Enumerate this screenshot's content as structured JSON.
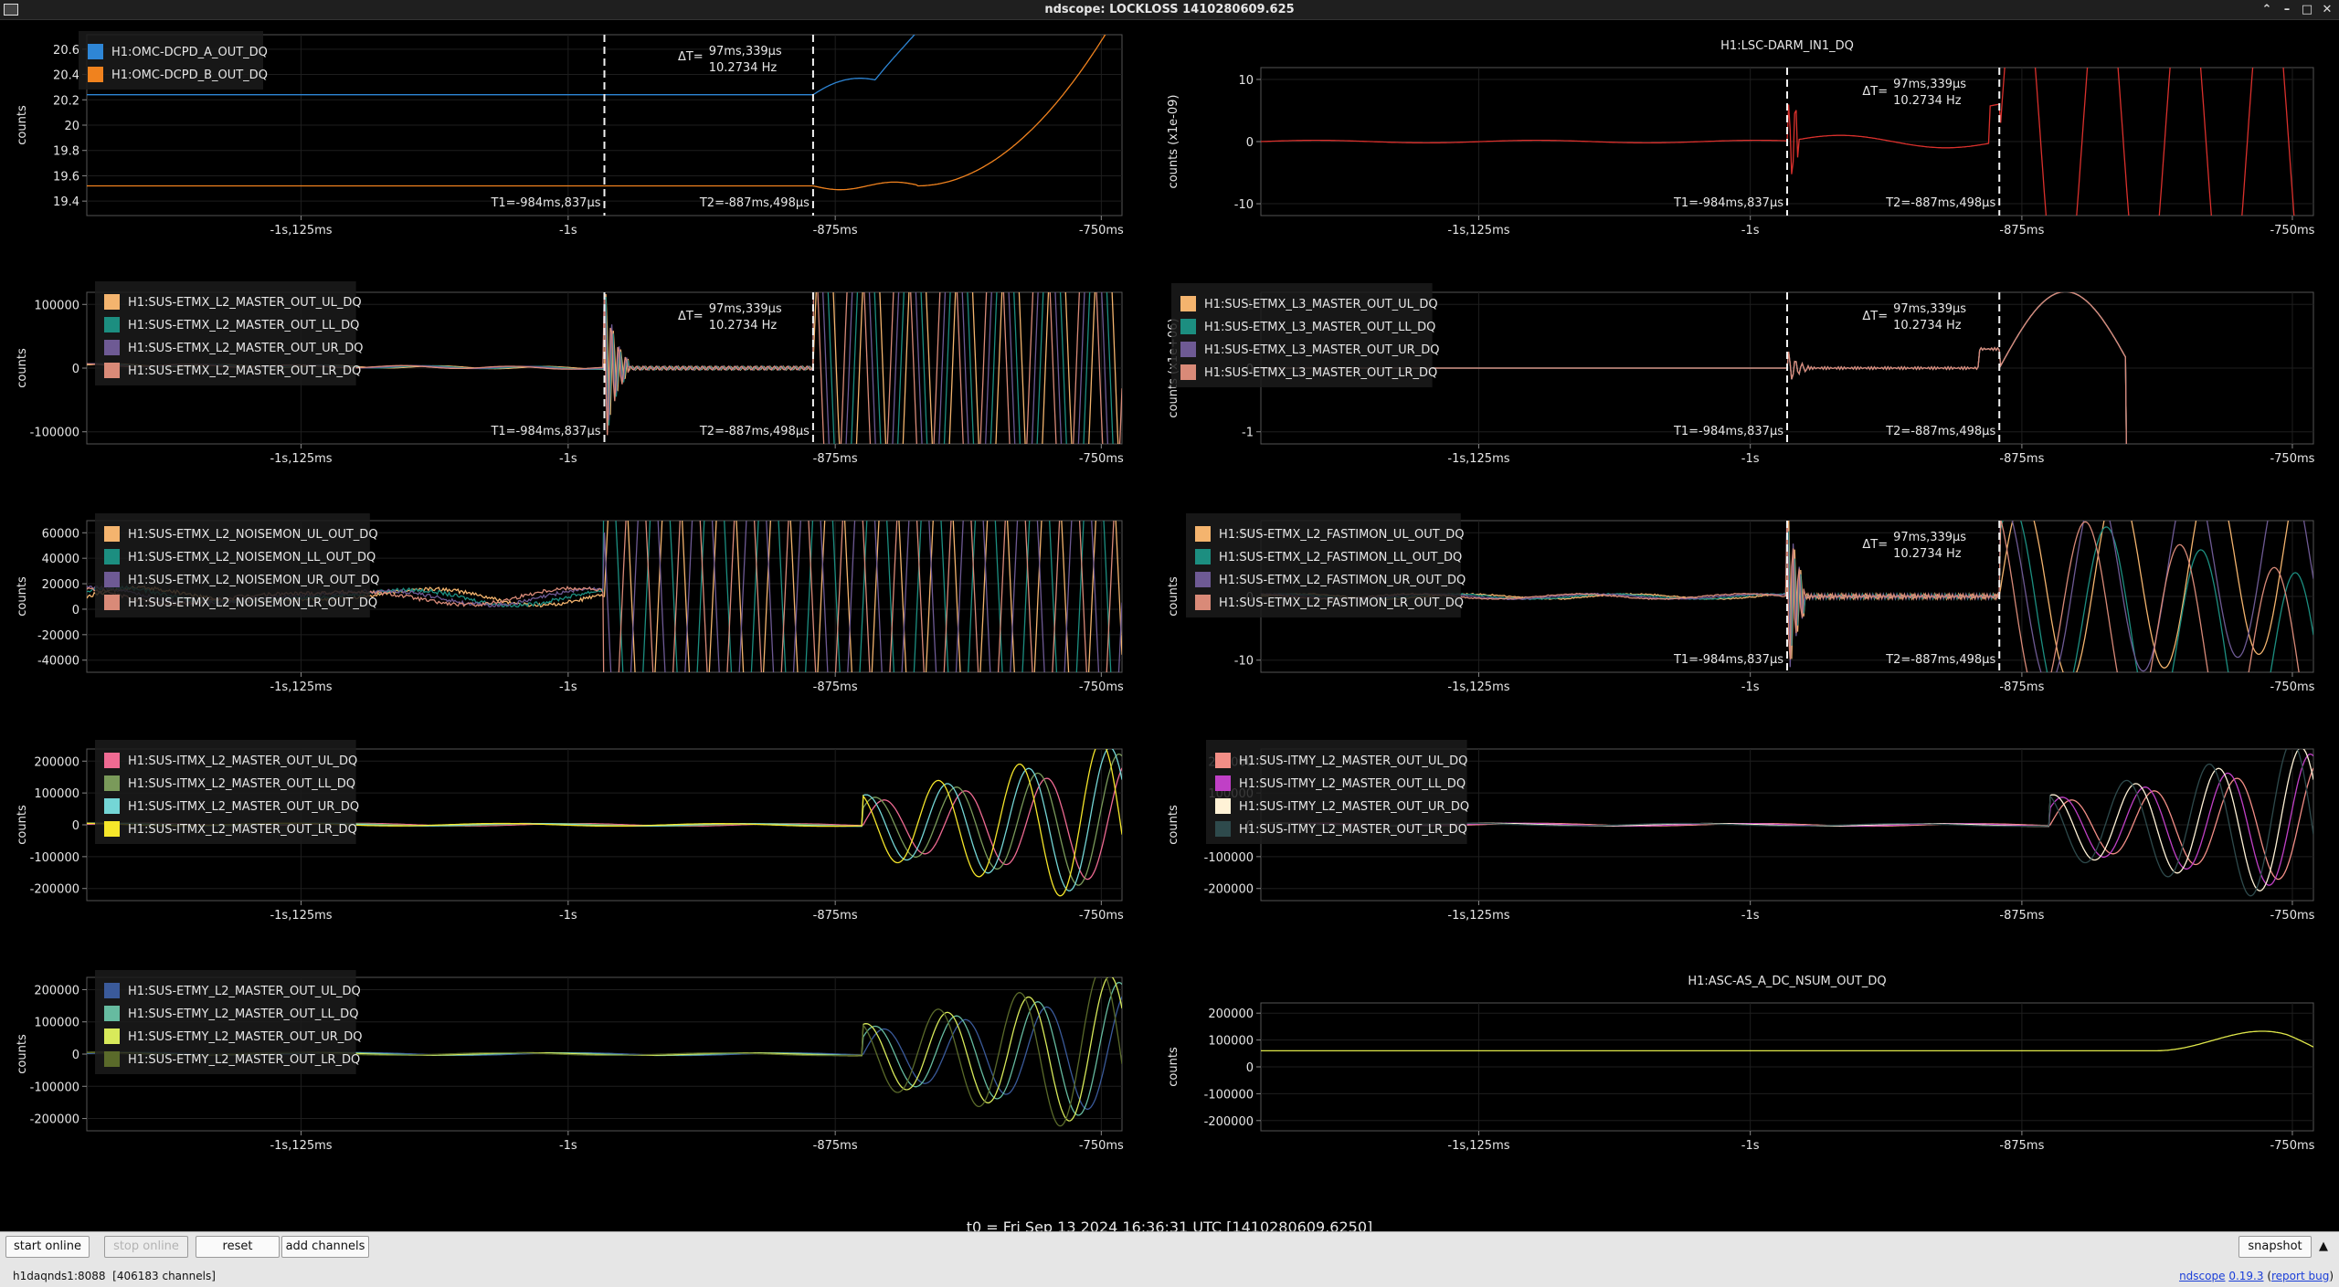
{
  "window": {
    "title": "ndscope: LOCKLOSS 1410280609.625"
  },
  "colors": {
    "c_blue": "#2e86d6",
    "c_orange": "#f0821e",
    "c_red": "#d9302c",
    "c_lo": "#f4b46e",
    "c_teal": "#1c8e80",
    "c_purple": "#6e5a94",
    "c_salmon": "#d98a78",
    "c_pink": "#ee6a92",
    "c_green": "#7a9a5a",
    "c_cyan": "#74d6d6",
    "c_yellow": "#f5e62a",
    "c_peach": "#f28e86",
    "c_magenta": "#c040c6",
    "c_cream": "#fff2d6",
    "c_dslate": "#2e4a4c",
    "c_navy": "#3a5a9a",
    "c_seafoam": "#66bba0",
    "c_lime": "#d8ea5a",
    "c_olive": "#5a6a2a",
    "c_nsum": "#e0e84a"
  },
  "x_ticks": [
    "-1s,125ms",
    "-1s",
    "-875ms",
    "-750ms"
  ],
  "cursor_labels": {
    "t1": "T1=-984ms,837μs",
    "t2": "T2=-887ms,498μs",
    "dt_prefix": "ΔT=",
    "dt_val": "97ms,339μs",
    "dt_freq": "10.2734 Hz"
  },
  "panels": [
    {
      "id": "p00",
      "title": "",
      "ylabel": "counts",
      "yticks": [
        "20.6",
        "20.4",
        "20.2",
        "20",
        "19.8",
        "19.6",
        "19.4"
      ],
      "channels": [
        {
          "name": "H1:OMC-DCPD_A_OUT_DQ",
          "color": "c_blue"
        },
        {
          "name": "H1:OMC-DCPD_B_OUT_DQ",
          "color": "c_orange"
        }
      ]
    },
    {
      "id": "p01",
      "title": "H1:LSC-DARM_IN1_DQ",
      "ylabel": "counts (x1e-09)",
      "yticks": [
        "10",
        "0",
        "-10"
      ],
      "channels": []
    },
    {
      "id": "p10",
      "title": "",
      "ylabel": "counts",
      "yticks": [
        "100000",
        "0",
        "-100000"
      ],
      "channels": [
        {
          "name": "H1:SUS-ETMX_L2_MASTER_OUT_UL_DQ",
          "color": "c_lo"
        },
        {
          "name": "H1:SUS-ETMX_L2_MASTER_OUT_LL_DQ",
          "color": "c_teal"
        },
        {
          "name": "H1:SUS-ETMX_L2_MASTER_OUT_UR_DQ",
          "color": "c_purple"
        },
        {
          "name": "H1:SUS-ETMX_L2_MASTER_OUT_LR_DQ",
          "color": "c_salmon"
        }
      ]
    },
    {
      "id": "p11",
      "title": "",
      "ylabel": "counts (x1e+06)",
      "yticks": [
        "1",
        "0",
        "-1"
      ],
      "channels": [
        {
          "name": "H1:SUS-ETMX_L3_MASTER_OUT_UL_DQ",
          "color": "c_lo"
        },
        {
          "name": "H1:SUS-ETMX_L3_MASTER_OUT_LL_DQ",
          "color": "c_teal"
        },
        {
          "name": "H1:SUS-ETMX_L3_MASTER_OUT_UR_DQ",
          "color": "c_purple"
        },
        {
          "name": "H1:SUS-ETMX_L3_MASTER_OUT_LR_DQ",
          "color": "c_salmon"
        }
      ]
    },
    {
      "id": "p20",
      "title": "",
      "ylabel": "counts",
      "yticks": [
        "60000",
        "40000",
        "20000",
        "0",
        "-20000",
        "-40000"
      ],
      "channels": [
        {
          "name": "H1:SUS-ETMX_L2_NOISEMON_UL_OUT_DQ",
          "color": "c_lo"
        },
        {
          "name": "H1:SUS-ETMX_L2_NOISEMON_LL_OUT_DQ",
          "color": "c_teal"
        },
        {
          "name": "H1:SUS-ETMX_L2_NOISEMON_UR_OUT_DQ",
          "color": "c_purple"
        },
        {
          "name": "H1:SUS-ETMX_L2_NOISEMON_LR_OUT_DQ",
          "color": "c_salmon"
        }
      ]
    },
    {
      "id": "p21",
      "title": "",
      "ylabel": "counts",
      "yticks": [
        "10",
        "0",
        "-10"
      ],
      "channels": [
        {
          "name": "H1:SUS-ETMX_L2_FASTIMON_UL_OUT_DQ",
          "color": "c_lo"
        },
        {
          "name": "H1:SUS-ETMX_L2_FASTIMON_LL_OUT_DQ",
          "color": "c_teal"
        },
        {
          "name": "H1:SUS-ETMX_L2_FASTIMON_UR_OUT_DQ",
          "color": "c_purple"
        },
        {
          "name": "H1:SUS-ETMX_L2_FASTIMON_LR_OUT_DQ",
          "color": "c_salmon"
        }
      ]
    },
    {
      "id": "p30",
      "title": "",
      "ylabel": "counts",
      "yticks": [
        "200000",
        "100000",
        "0",
        "-100000",
        "-200000"
      ],
      "channels": [
        {
          "name": "H1:SUS-ITMX_L2_MASTER_OUT_UL_DQ",
          "color": "c_pink"
        },
        {
          "name": "H1:SUS-ITMX_L2_MASTER_OUT_LL_DQ",
          "color": "c_green"
        },
        {
          "name": "H1:SUS-ITMX_L2_MASTER_OUT_UR_DQ",
          "color": "c_cyan"
        },
        {
          "name": "H1:SUS-ITMX_L2_MASTER_OUT_LR_DQ",
          "color": "c_yellow"
        }
      ]
    },
    {
      "id": "p31",
      "title": "",
      "ylabel": "counts",
      "yticks": [
        "200000",
        "100000",
        "0",
        "-100000",
        "-200000"
      ],
      "channels": [
        {
          "name": "H1:SUS-ITMY_L2_MASTER_OUT_UL_DQ",
          "color": "c_peach"
        },
        {
          "name": "H1:SUS-ITMY_L2_MASTER_OUT_LL_DQ",
          "color": "c_magenta"
        },
        {
          "name": "H1:SUS-ITMY_L2_MASTER_OUT_UR_DQ",
          "color": "c_cream"
        },
        {
          "name": "H1:SUS-ITMY_L2_MASTER_OUT_LR_DQ",
          "color": "c_dslate"
        }
      ]
    },
    {
      "id": "p40",
      "title": "",
      "ylabel": "counts",
      "yticks": [
        "200000",
        "100000",
        "0",
        "-100000",
        "-200000"
      ],
      "channels": [
        {
          "name": "H1:SUS-ETMY_L2_MASTER_OUT_UL_DQ",
          "color": "c_navy"
        },
        {
          "name": "H1:SUS-ETMY_L2_MASTER_OUT_LL_DQ",
          "color": "c_seafoam"
        },
        {
          "name": "H1:SUS-ETMY_L2_MASTER_OUT_UR_DQ",
          "color": "c_lime"
        },
        {
          "name": "H1:SUS-ETMY_L2_MASTER_OUT_LR_DQ",
          "color": "c_olive"
        }
      ]
    },
    {
      "id": "p41",
      "title": "H1:ASC-AS_A_DC_NSUM_OUT_DQ",
      "ylabel": "counts",
      "yticks": [
        "200000",
        "100000",
        "0",
        "-100000",
        "-200000"
      ],
      "channels": []
    }
  ],
  "t0_text": "t0 = Fri Sep 13 2024 16:36:31 UTC [1410280609.6250]",
  "toolbar": {
    "start_online": "start online",
    "stop_online": "stop online",
    "reset": "reset",
    "add_channels": "add channels",
    "snapshot": "snapshot"
  },
  "status": {
    "server": "h1daqnds1:8088",
    "channels": "[406183 channels]",
    "app_link": "ndscope",
    "version": "0.19.3",
    "report_bug": "report bug"
  }
}
